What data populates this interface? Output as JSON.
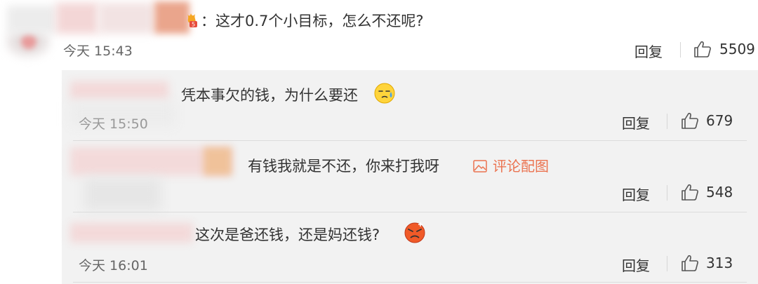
{
  "main_comment": {
    "text": "这才0.7个小目标，怎么不还呢?",
    "colon": "：",
    "time": "今天 15:43",
    "reply_label": "回复",
    "likes": "5509"
  },
  "replies": [
    {
      "text": "凭本事欠的钱，为什么要还",
      "time": "今天 15:50",
      "reply_label": "回复",
      "likes": "679",
      "emoji": "sweating-face-icon"
    },
    {
      "text": "有钱我就是不还，你来打我呀",
      "image_link": "评论配图",
      "reply_label": "回复",
      "likes": "548"
    },
    {
      "text": "这次是爸还钱，还是妈还钱?",
      "time": "今天 16:01",
      "reply_label": "回复",
      "likes": "313",
      "emoji": "angry-face-icon"
    }
  ],
  "colors": {
    "link": "#eb7350",
    "reply_bg": "#f2f2f2",
    "text": "#333333",
    "meta": "#666666"
  }
}
